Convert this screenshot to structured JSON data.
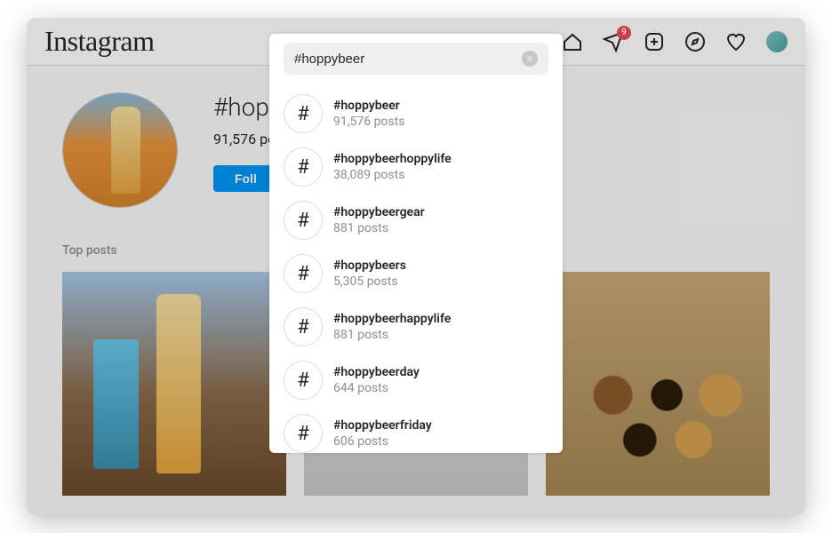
{
  "app": {
    "logo": "Instagram"
  },
  "nav": {
    "dm_badge": "9"
  },
  "profile": {
    "title_truncated": "#hopp",
    "posts_count_truncated": "91,576 pos",
    "follow_label": "Foll"
  },
  "section": {
    "top_posts_label": "Top posts"
  },
  "search": {
    "value": "#hoppybeer",
    "results": [
      {
        "name": "#hoppybeer",
        "count": "91,576 posts"
      },
      {
        "name": "#hoppybeerhoppylife",
        "count": "38,089 posts"
      },
      {
        "name": "#hoppybeergear",
        "count": "881 posts"
      },
      {
        "name": "#hoppybeers",
        "count": "5,305 posts"
      },
      {
        "name": "#hoppybeerhappylife",
        "count": "881 posts"
      },
      {
        "name": "#hoppybeerday",
        "count": "644 posts"
      },
      {
        "name": "#hoppybeerfriday",
        "count": "606 posts"
      }
    ]
  }
}
